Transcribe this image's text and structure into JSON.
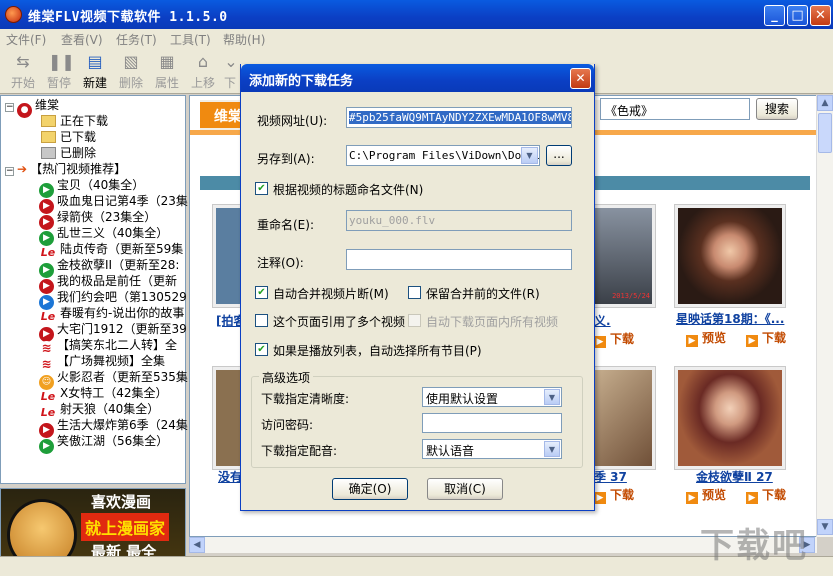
{
  "window": {
    "title": "维棠FLV视频下载软件 1.1.5.0"
  },
  "menu": [
    "文件(F)",
    "查看(V)",
    "任务(T)",
    "工具(T)",
    "帮助(H)"
  ],
  "toolbar": [
    {
      "label": "开始",
      "icon": "play-icon",
      "enabled": false
    },
    {
      "label": "暂停",
      "icon": "pause-icon",
      "enabled": false
    },
    {
      "label": "新建",
      "icon": "new-file-icon",
      "enabled": true
    },
    {
      "label": "删除",
      "icon": "delete-icon",
      "enabled": false
    },
    {
      "label": "属性",
      "icon": "properties-icon",
      "enabled": false
    },
    {
      "label": "上移",
      "icon": "move-up-icon",
      "enabled": false
    },
    {
      "label": "下",
      "icon": "move-down-icon",
      "enabled": false
    }
  ],
  "tree": {
    "root": "维棠",
    "folders": [
      "正在下载",
      "已下载",
      "已删除"
    ],
    "hot_group": "【热门视频推荐】",
    "items": [
      {
        "label": "宝贝（40集全）",
        "glyph": "green"
      },
      {
        "label": "吸血鬼日记第4季（23集",
        "glyph": "red"
      },
      {
        "label": "绿箭侠（23集全）",
        "glyph": "red"
      },
      {
        "label": "乱世三义（40集全）",
        "glyph": "green"
      },
      {
        "label": "陆贞传奇（更新至59集",
        "glyph": "le"
      },
      {
        "label": "金枝欲孽II（更新至28:",
        "glyph": "green"
      },
      {
        "label": "我的极品是前任（更新",
        "glyph": "red"
      },
      {
        "label": "我们约会吧（第130529",
        "glyph": "blue"
      },
      {
        "label": "春暖有约-说出你的故事",
        "glyph": "le"
      },
      {
        "label": "大宅门1912（更新至39",
        "glyph": "red"
      },
      {
        "label": "【搞笑东北二人转】全",
        "glyph": "wifi"
      },
      {
        "label": "【广场舞视频】全集",
        "glyph": "wifi"
      },
      {
        "label": "火影忍者（更新至535集",
        "glyph": "orange"
      },
      {
        "label": "X女特工（42集全）",
        "glyph": "le"
      },
      {
        "label": "射天狼（40集全）",
        "glyph": "le"
      },
      {
        "label": "生活大爆炸第6季（24集",
        "glyph": "red"
      },
      {
        "label": "笑傲江湖（56集全）",
        "glyph": "green"
      }
    ]
  },
  "ad": {
    "line1": "喜欢漫画",
    "line2": "就上漫画家",
    "line3": "最新 最全"
  },
  "web": {
    "header_partial": "维棠",
    "search_value": "《色戒》",
    "search_button": "搜索",
    "tiles": [
      {
        "caption": "[拍客",
        "dl": ""
      },
      {
        "caption": "义.",
        "dl": "下载"
      },
      {
        "caption": "星映话第18期：《...",
        "preview": "预览",
        "dl": "下载"
      },
      {
        "caption": "没有",
        "dl": ""
      },
      {
        "caption": "季 37",
        "dl": "下载"
      },
      {
        "caption": "金枝欲孽Ⅱ 27",
        "preview": "预览",
        "dl": "下载"
      }
    ],
    "stamp_text": "2013/5/24"
  },
  "dialog": {
    "title": "添加新的下载任务",
    "url_label": "视频网址(U):",
    "url_value": "#5pb25faWQ9MTAyNDY2ZXEwMDA1OF8wMV8wMg",
    "saveto_label": "另存到(A):",
    "saveto_value": "C:\\Program Files\\ViDown\\Downl",
    "browse_label": "...",
    "rename_by_title_label": "根据视频的标题命名文件(N)",
    "rename_label": "重命名(E):",
    "rename_value": "youku_000.flv",
    "note_label": "注释(O):",
    "note_value": "",
    "auto_merge_label": "自动合并视频片断(M)",
    "keep_before_merge_label": "保留合并前的文件(R)",
    "multi_video_label": "这个页面引用了多个视频",
    "auto_download_all_label": "自动下载页面内所有视频",
    "playlist_label": "如果是播放列表，自动选择所有节目(P)",
    "advanced_group": "高级选项",
    "quality_label": "下载指定清晰度:",
    "quality_value": "使用默认设置",
    "password_label": "访问密码:",
    "password_value": "",
    "dub_label": "下载指定配音:",
    "dub_value": "默认语音",
    "ok_label": "确定(O)",
    "cancel_label": "取消(C)",
    "checks": {
      "rename_by_title": true,
      "auto_merge": true,
      "keep_before_merge": false,
      "multi_video": false,
      "auto_download_all": false,
      "playlist": true
    }
  },
  "watermark": "下载吧"
}
